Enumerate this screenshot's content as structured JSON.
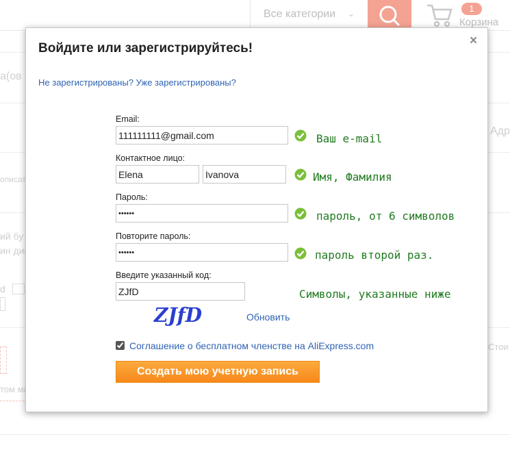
{
  "background": {
    "category_label": "Все категории",
    "cart_count": "1",
    "cart_label": "Корзина",
    "frag_left_1": "а(ов",
    "frag_left_2": "описат",
    "frag_left_3": "ий бу",
    "frag_left_4": "ин диа",
    "frag_left_5": "d",
    "frag_left_6": "том ма",
    "frag_right_1": "Адр",
    "frag_right_2": "Стои"
  },
  "modal": {
    "title": "Войдите или зарегистрируйтесь!",
    "close": "×",
    "tab_register": "Не зарегистрированы?",
    "tab_login": "Уже зарегистрированы?"
  },
  "form": {
    "email_label": "Email:",
    "email_value": "111111111@gmail.com",
    "contact_label": "Контактное лицо:",
    "first_name_value": "Elena",
    "last_name_value": "Ivanova",
    "password_label": "Пароль:",
    "password_value": "••••••",
    "repeat_label": "Повторите пароль:",
    "repeat_value": "••••••",
    "code_label": "Введите указанный код:",
    "code_value": "ZJfD",
    "captcha_text": "ZJfD",
    "refresh_label": "Обновить",
    "agreement_label": "Соглашение о бесплатном членстве на AliExpress.com",
    "agreement_checked": true,
    "submit_label": "Создать мою учетную запись"
  },
  "hints": {
    "email": "Ваш e-mail",
    "name": "Имя, Фамилия",
    "password": "пароль, от 6 символов",
    "repeat": "пароль второй раз.",
    "code": "Символы, указанные ниже"
  },
  "colors": {
    "accent_orange": "#f7881a",
    "link_blue": "#2f63b4",
    "hint_green": "#1f7a1f",
    "ok_green": "#7bbf3a"
  }
}
